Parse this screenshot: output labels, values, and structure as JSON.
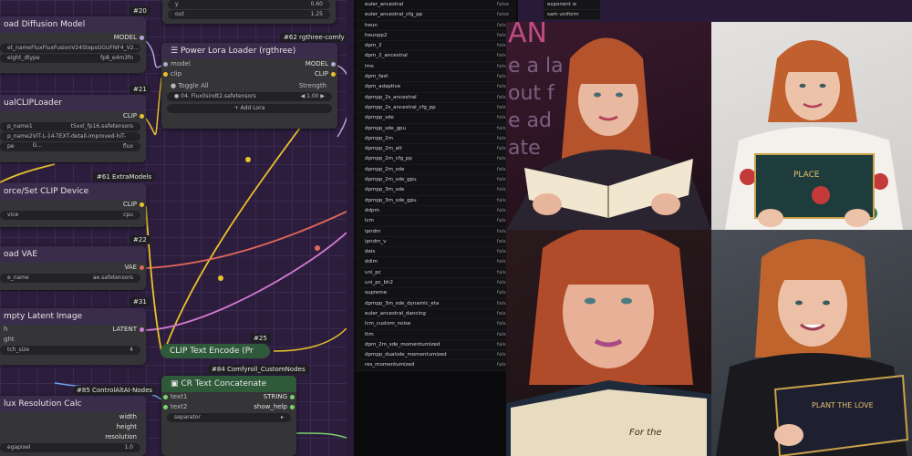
{
  "nodes": {
    "load_diffusion": {
      "badge": "#20",
      "title": "oad Diffusion Model",
      "output": "MODEL",
      "widgets": [
        {
          "label": "et_name",
          "value": "FluxFluxFusionV24StepsGGUFNF4_V2..."
        },
        {
          "label": "eight_dtype",
          "value": "fp8_e4m3fn"
        }
      ]
    },
    "dual_clip": {
      "badge": "#21",
      "title": "ualCLIPLoader",
      "output": "CLIP",
      "widgets": [
        {
          "label": "p_name1",
          "value": "t5xxl_fp16.safetensors"
        },
        {
          "label": "p_name2",
          "value": "ViT-L-14-TEXT-detail-improved-hiT-G..."
        },
        {
          "label": "pe",
          "value": "flux"
        }
      ]
    },
    "force_clip": {
      "badge": "#61 ExtraModels",
      "title": "orce/Set CLIP Device",
      "output": "CLIP",
      "widgets": [
        {
          "label": "vice",
          "value": "cpu"
        }
      ]
    },
    "load_vae": {
      "badge": "#22",
      "title": "oad VAE",
      "output": "VAE",
      "widgets": [
        {
          "label": "e_name",
          "value": "ae.safetensors"
        }
      ]
    },
    "empty_latent": {
      "badge": "#31",
      "title": "mpty Latent Image",
      "output": "LATENT",
      "inputs": [
        "h",
        "ght"
      ],
      "widgets": [
        {
          "label": "tch_size",
          "value": "4"
        }
      ]
    },
    "flux_res": {
      "badge": "#85 ControlAltAI-Nodes",
      "title": "lux Resolution Calc",
      "outputs": [
        "width",
        "height",
        "resolution"
      ],
      "widgets": [
        {
          "label": "egapixel",
          "value": "1.0"
        }
      ]
    },
    "power_lora": {
      "badge": "#62 rgthree-comfy",
      "title": "Power Lora Loader (rgthree)",
      "inputs": [
        "model",
        "clip"
      ],
      "outputs": [
        "MODEL",
        "CLIP"
      ],
      "toggle_all": "Toggle All",
      "strength_label": "Strength",
      "lora_name": "04. Fluxlisindt2.safetensors",
      "lora_strength": "1.00",
      "add_lora": "Add Lora",
      "top_widgets": [
        {
          "label": "y",
          "value": "0.60"
        },
        {
          "label": "out",
          "value": "1.25"
        }
      ]
    },
    "clip_text_encode": {
      "badge": "#25",
      "title": "CLIP Text Encode (Pr"
    },
    "cr_text_concat": {
      "badge": "#84 Comfyroll_CustomNodes",
      "title": "CR Text Concatenate",
      "inputs": [
        "text1",
        "text2"
      ],
      "outputs": [
        "STRING",
        "show_help"
      ],
      "separator": "separator"
    }
  },
  "sampler_list": [
    {
      "name": "euler_ancestral",
      "value": "false"
    },
    {
      "name": "euler_ancestral_cfg_pp",
      "value": "false"
    },
    {
      "name": "heun",
      "value": "false"
    },
    {
      "name": "heunpp2",
      "value": "false"
    },
    {
      "name": "dpm_2",
      "value": "false"
    },
    {
      "name": "dpm_2_ancestral",
      "value": "false"
    },
    {
      "name": "lms",
      "value": "false"
    },
    {
      "name": "dpm_fast",
      "value": "false"
    },
    {
      "name": "dpm_adaptive",
      "value": "false"
    },
    {
      "name": "dpmpp_2s_ancestral",
      "value": "false"
    },
    {
      "name": "dpmpp_2s_ancestral_cfg_pp",
      "value": "false"
    },
    {
      "name": "dpmpp_sde",
      "value": "false"
    },
    {
      "name": "dpmpp_sde_gpu",
      "value": "false"
    },
    {
      "name": "dpmpp_2m",
      "value": "false"
    },
    {
      "name": "dpmpp_2m_alt",
      "value": "false"
    },
    {
      "name": "dpmpp_2m_cfg_pp",
      "value": "false"
    },
    {
      "name": "dpmpp_2m_sde",
      "value": "false"
    },
    {
      "name": "dpmpp_2m_sde_gpu",
      "value": "false"
    },
    {
      "name": "dpmpp_3m_sde",
      "value": "false"
    },
    {
      "name": "dpmpp_3m_sde_gpu",
      "value": "false"
    },
    {
      "name": "ddpm",
      "value": "false"
    },
    {
      "name": "lcm",
      "value": "false"
    },
    {
      "name": "ipndm",
      "value": "false"
    },
    {
      "name": "ipndm_v",
      "value": "false"
    },
    {
      "name": "deis",
      "value": "false"
    },
    {
      "name": "ddim",
      "value": "false"
    },
    {
      "name": "uni_pc",
      "value": "false"
    },
    {
      "name": "uni_pc_bh2",
      "value": "false"
    },
    {
      "name": "supreme",
      "value": "false"
    },
    {
      "name": "dpmpp_3m_sde_dynamic_eta",
      "value": "false"
    },
    {
      "name": "euler_ancestral_dancing",
      "value": "false"
    },
    {
      "name": "lcm_custom_noise",
      "value": "false"
    },
    {
      "name": "ttm",
      "value": "false"
    },
    {
      "name": "dpm_2m_sde_momentumized",
      "value": "false"
    },
    {
      "name": "dpmpp_dualsde_momentumized",
      "value": "false"
    },
    {
      "name": "res_momentumized",
      "value": "false"
    }
  ],
  "far_list": [
    "exponent  ≡",
    "sam uniform"
  ],
  "book_texts": {
    "top_right": "PLACE",
    "bottom_left": "For the",
    "bottom_right": "PLANT THE LOVE"
  },
  "colors": {
    "canvas": "#2c1d3d",
    "node": "#353538",
    "green_node": "#2f5a3a",
    "wire_yellow": "#e8c22a",
    "wire_orange": "#e2685a",
    "wire_pink": "#d57bd1",
    "wire_green": "#7bd36b"
  }
}
